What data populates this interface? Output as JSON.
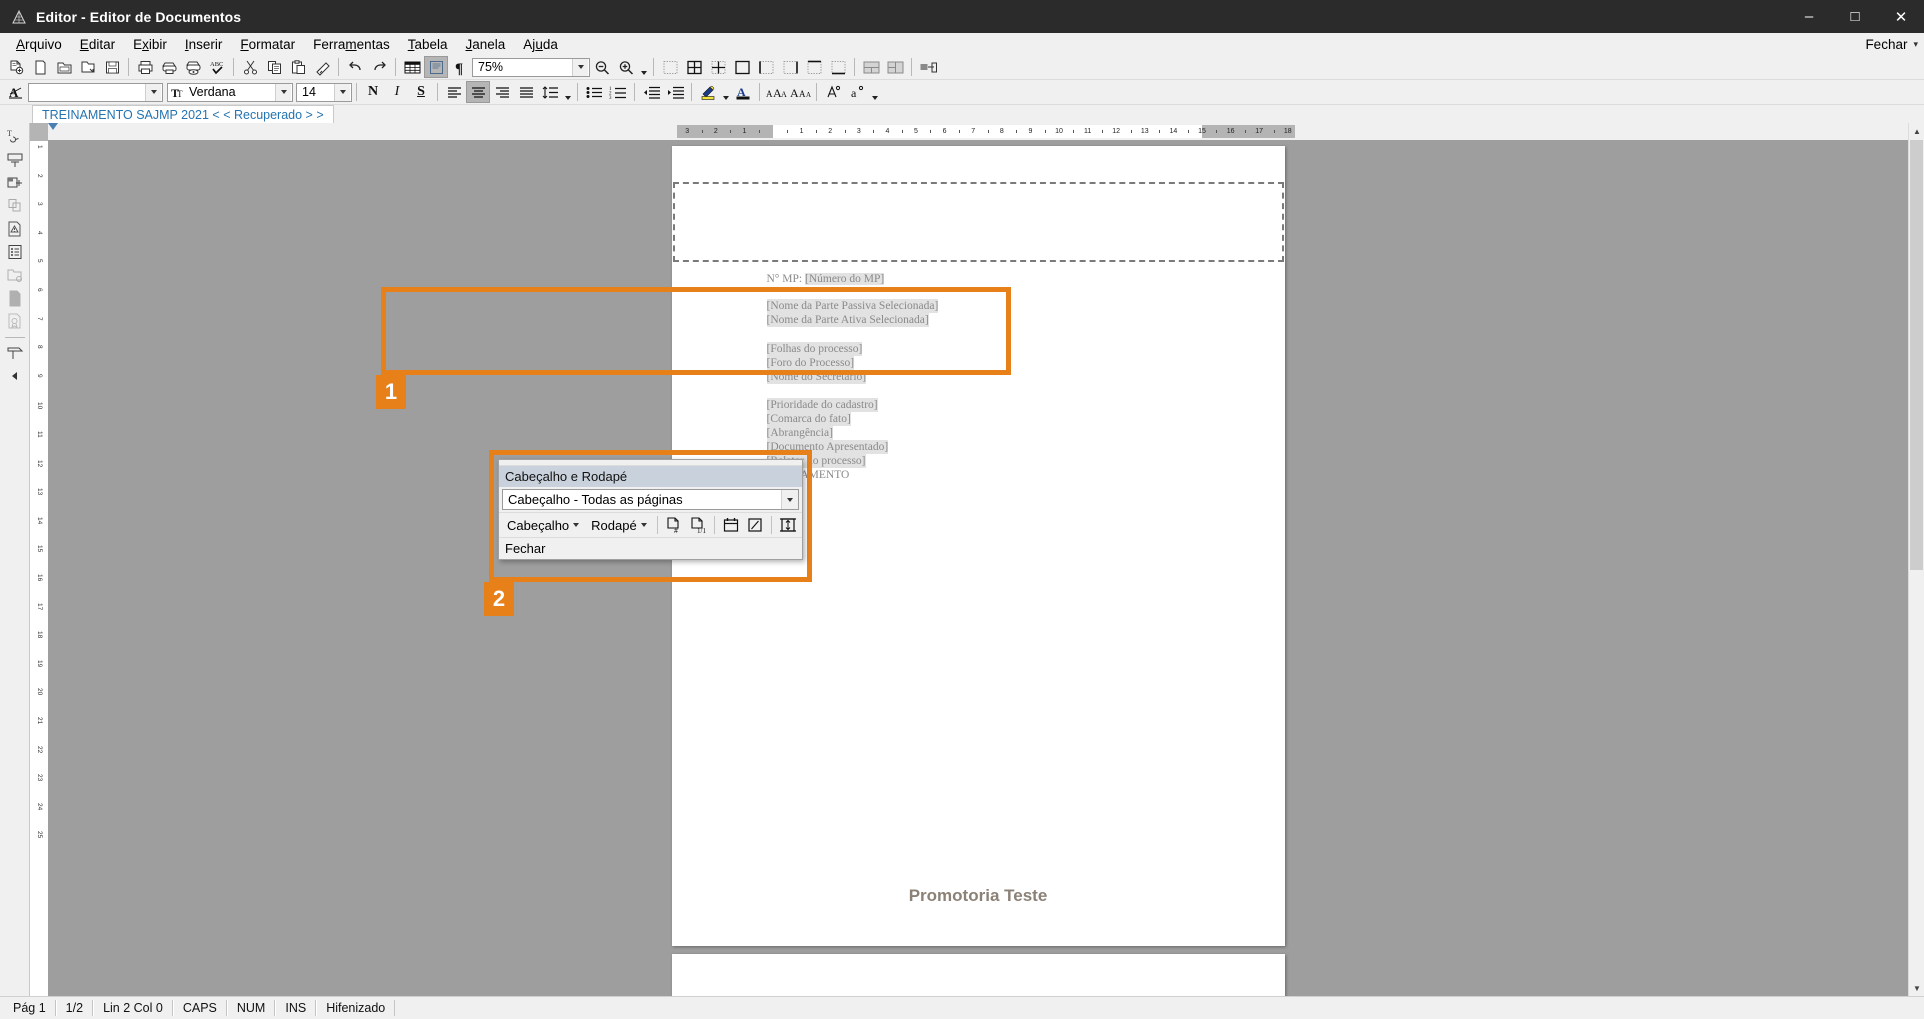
{
  "window": {
    "title": "Editor - Editor de Documentos",
    "app_icon": "pyramid-icon",
    "buttons": {
      "minimize": "–",
      "maximize": "□",
      "close": "✕"
    }
  },
  "menubar": {
    "items": [
      {
        "label": "Arquivo",
        "accel": "A"
      },
      {
        "label": "Editar",
        "accel": "E"
      },
      {
        "label": "Exibir",
        "accel": "x"
      },
      {
        "label": "Inserir",
        "accel": "I"
      },
      {
        "label": "Formatar",
        "accel": "F"
      },
      {
        "label": "Ferramentas",
        "accel": "m"
      },
      {
        "label": "Tabela",
        "accel": "T"
      },
      {
        "label": "Janela",
        "accel": "J"
      },
      {
        "label": "Ajuda",
        "accel": "u"
      }
    ],
    "right_label": "Fechar"
  },
  "toolbar_standard": {
    "zoom_value": "75%",
    "buttons": [
      {
        "name": "new-document-icon",
        "title": "Novo"
      },
      {
        "name": "blank-page-icon",
        "title": "Documento em branco"
      },
      {
        "name": "open-folder-icon",
        "title": "Abrir"
      },
      {
        "name": "open-recent-icon",
        "title": "Abrir recente"
      },
      {
        "name": "save-icon",
        "title": "Salvar"
      },
      {
        "name": "print-icon",
        "title": "Imprimir"
      },
      {
        "name": "print-setup-icon",
        "title": "Configurar impressao"
      },
      {
        "name": "print-preview-icon",
        "title": "Visualizar impressao"
      },
      {
        "name": "spellcheck-abc-icon",
        "title": "Ortografia"
      },
      {
        "name": "cut-scissors-icon",
        "title": "Recortar"
      },
      {
        "name": "copy-icon",
        "title": "Copiar"
      },
      {
        "name": "paste-icon",
        "title": "Colar"
      },
      {
        "name": "format-painter-icon",
        "title": "Pincel de formatacao"
      },
      {
        "name": "undo-icon",
        "title": "Desfazer"
      },
      {
        "name": "redo-icon",
        "title": "Refazer"
      },
      {
        "name": "table-grid-icon",
        "title": "Tabela"
      },
      {
        "name": "page-view-icon",
        "title": "Exibicao de pagina"
      },
      {
        "name": "formatting-marks-pilcrow-icon",
        "title": "Marcas de formatacao"
      },
      {
        "name": "zoom-out-icon",
        "title": "Reduzir zoom"
      },
      {
        "name": "zoom-in-icon",
        "title": "Ampliar zoom"
      },
      {
        "name": "borders-none-icon",
        "title": "Sem bordas"
      },
      {
        "name": "borders-all-icon",
        "title": "Todas as bordas"
      },
      {
        "name": "borders-inner-icon",
        "title": "Bordas internas"
      },
      {
        "name": "borders-outer-icon",
        "title": "Bordas externas"
      },
      {
        "name": "borders-left-icon",
        "title": "Borda esquerda"
      },
      {
        "name": "borders-right-icon",
        "title": "Borda direita"
      },
      {
        "name": "borders-top-icon",
        "title": "Borda superior"
      },
      {
        "name": "borders-bottom-icon",
        "title": "Borda inferior"
      },
      {
        "name": "merge-cells-icon",
        "title": "Mesclar celulas"
      },
      {
        "name": "split-cells-icon",
        "title": "Dividir celulas"
      },
      {
        "name": "insert-field-icon",
        "title": "Inserir campo"
      }
    ]
  },
  "toolbar_format": {
    "style_value": "",
    "style_placeholder": "",
    "font_value": "Verdana",
    "size_value": "14",
    "buttons": [
      {
        "name": "paragraph-style-icon",
        "title": "Estilo de paragrafo"
      },
      {
        "name": "bold-icon",
        "label": "N",
        "title": "Negrito"
      },
      {
        "name": "italic-icon",
        "label": "I",
        "title": "Italico"
      },
      {
        "name": "underline-icon",
        "label": "S",
        "title": "Sublinhado"
      },
      {
        "name": "align-left-icon",
        "title": "Alinhar a esquerda"
      },
      {
        "name": "align-center-icon",
        "title": "Centralizar",
        "pressed": true
      },
      {
        "name": "align-right-icon",
        "title": "Alinhar a direita"
      },
      {
        "name": "align-justify-icon",
        "title": "Justificar"
      },
      {
        "name": "line-spacing-icon",
        "title": "Espacamento entre linhas"
      },
      {
        "name": "bullet-list-icon",
        "title": "Lista com marcadores"
      },
      {
        "name": "numbered-list-icon",
        "title": "Lista numerada"
      },
      {
        "name": "decrease-indent-icon",
        "title": "Diminuir recuo"
      },
      {
        "name": "increase-indent-icon",
        "title": "Aumentar recuo"
      },
      {
        "name": "highlight-color-icon",
        "title": "Cor de realce"
      },
      {
        "name": "font-color-icon",
        "title": "Cor da fonte"
      },
      {
        "name": "change-case-icon",
        "title": "Maiusculas e minusculas"
      },
      {
        "name": "change-case-alt-icon",
        "title": "Alternar caixa"
      },
      {
        "name": "insert-symbol-icon",
        "title": "Inserir simbolo"
      },
      {
        "name": "special-char-icon",
        "title": "Caractere especial"
      }
    ]
  },
  "leftbar": {
    "buttons": [
      {
        "name": "text-cursor-icon"
      },
      {
        "name": "text-box-icon"
      },
      {
        "name": "insert-block-icon"
      },
      {
        "name": "copy-block-icon"
      },
      {
        "name": "alert-document-icon"
      },
      {
        "name": "list-document-icon"
      },
      {
        "name": "folder-doc-icon"
      },
      {
        "name": "plain-page-icon"
      },
      {
        "name": "certificate-doc-icon"
      },
      {
        "name": "stamp-icon"
      },
      {
        "name": "collapse-arrow-icon"
      }
    ]
  },
  "tab": {
    "label": "TREINAMENTO SAJMP 2021 < < Recuperado > >"
  },
  "ruler": {
    "unit_marks_left": [
      "3",
      "2",
      "1"
    ],
    "unit_marks_right": [
      "1",
      "2",
      "3",
      "4",
      "5",
      "6",
      "7",
      "8",
      "9",
      "10",
      "11",
      "12",
      "13",
      "14",
      "15",
      "16",
      "17",
      "18"
    ],
    "left_indent_pos": "0",
    "right_indent_pos": "15"
  },
  "vertical_ruler": {
    "marks": [
      "1",
      "2",
      "3",
      "4",
      "5",
      "6",
      "7",
      "8",
      "9",
      "10",
      "11",
      "12",
      "13",
      "14",
      "15",
      "16",
      "17",
      "18",
      "19",
      "20",
      "21",
      "22",
      "23",
      "24",
      "25"
    ]
  },
  "document": {
    "header_placeholder": "",
    "lines": [
      {
        "prefix": "N° MP: ",
        "field": "[Número do MP]"
      },
      {
        "prefix": "",
        "field": "[Nome da Parte Passiva Selecionada]"
      },
      {
        "prefix": "",
        "field": "[Nome da Parte Ativa Selecionada]"
      },
      {
        "prefix": "",
        "field": "[Folhas do processo]"
      },
      {
        "prefix": "",
        "field": "[Foro do Processo]"
      },
      {
        "prefix": "",
        "field": "[Nome do Secretário]"
      },
      {
        "prefix": "",
        "field": "[Prioridade do cadastro]"
      },
      {
        "prefix": "",
        "field": "[Comarca do fato]"
      },
      {
        "prefix": "",
        "field": "[Abrangência]"
      },
      {
        "prefix": "",
        "field": "[Documento Apresentado]"
      },
      {
        "prefix": "",
        "field": "[Relator do processo]"
      },
      {
        "prefix": "",
        "field": "TREINAMENTO"
      }
    ],
    "footer_text": "Promotoria Teste"
  },
  "annotations": [
    {
      "number": "1",
      "target": "header-area"
    },
    {
      "number": "2",
      "target": "header-footer-dialog"
    }
  ],
  "hf_dialog": {
    "title": "Cabeçalho e Rodapé",
    "scope_value": "Cabeçalho -  Todas as páginas",
    "menus": [
      {
        "name": "hf-menu-cabecalho",
        "label": "Cabeçalho"
      },
      {
        "name": "hf-menu-rodape",
        "label": "Rodapé"
      }
    ],
    "icon_buttons": [
      {
        "name": "page-number-icon",
        "title": "Número da página"
      },
      {
        "name": "page-count-icon",
        "title": "Total de páginas"
      },
      {
        "name": "insert-date-icon",
        "title": "Inserir data"
      },
      {
        "name": "insert-time-icon",
        "title": "Inserir hora"
      },
      {
        "name": "page-setup-icon",
        "title": "Configurar página"
      }
    ],
    "close_label": "Fechar"
  },
  "statusbar": {
    "cells": [
      "Pág 1",
      "1/2",
      "Lin 2  Col 0",
      "CAPS",
      "NUM",
      "INS",
      "Hifenizado"
    ]
  },
  "colors": {
    "annotation": "#e8801a",
    "titlebar": "#2b2b2b",
    "tab_text": "#2574b0",
    "dialog_title_bg": "#c9d2dc",
    "field_shade": "#e2e2e2",
    "footer_text": "#8b8176",
    "chrome": "#f0f0f0",
    "canvas": "#9e9e9e"
  }
}
